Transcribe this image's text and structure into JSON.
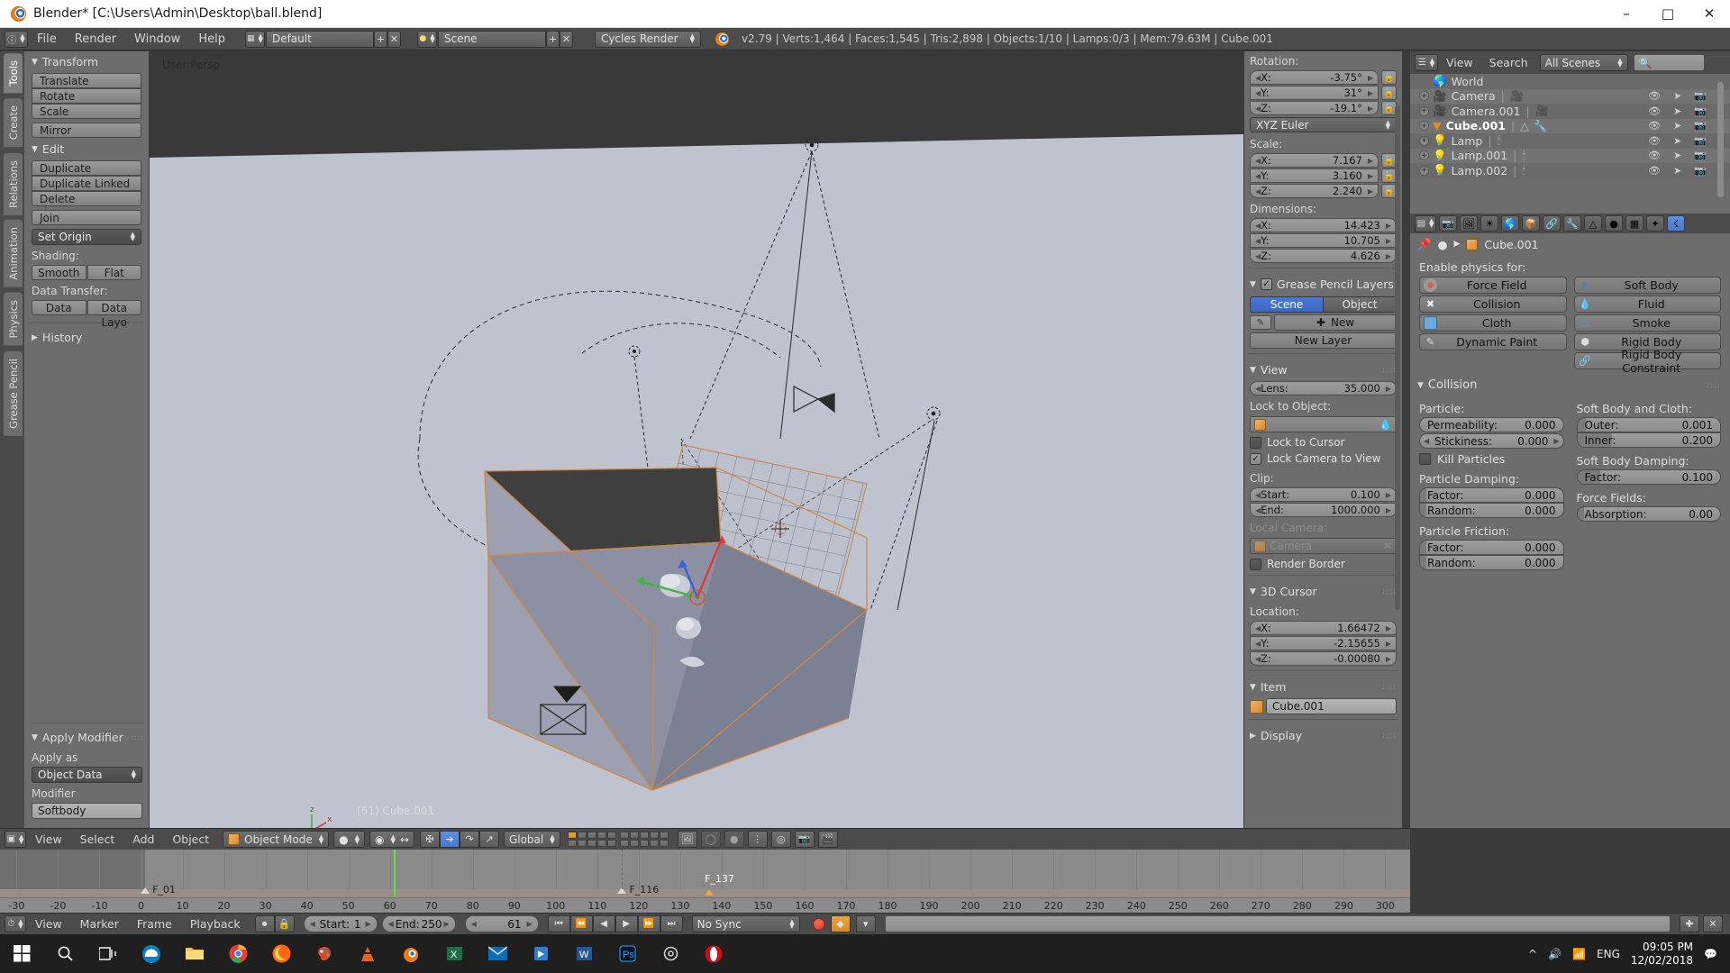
{
  "window": {
    "title": "Blender* [C:\\Users\\Admin\\Desktop\\ball.blend]",
    "minimize": "–",
    "maximize": "□",
    "close": "✕"
  },
  "topbar": {
    "menus": [
      "File",
      "Render",
      "Window",
      "Help"
    ],
    "screen_layout": "Default",
    "scene": "Scene",
    "render_engine": "Cycles Render",
    "status": "v2.79 | Verts:1,464 | Faces:1,545 | Tris:2,898 | Objects:1/10 | Lamps:0/3 | Mem:79.63M | Cube.001",
    "plus": "+",
    "x": "✕"
  },
  "toolshelf": {
    "tabs": [
      "Tools",
      "Create",
      "Relations",
      "Animation",
      "Physics",
      "Grease Pencil"
    ],
    "active_tab": "Tools",
    "transform": {
      "title": "Transform",
      "buttons": [
        "Translate",
        "Rotate",
        "Scale"
      ],
      "mirror": "Mirror"
    },
    "edit": {
      "title": "Edit",
      "buttons": [
        "Duplicate",
        "Duplicate Linked",
        "Delete"
      ],
      "join": "Join",
      "set_origin": "Set Origin",
      "shading_label": "Shading:",
      "shading": [
        "Smooth",
        "Flat"
      ],
      "data_transfer_label": "Data Transfer:",
      "data_transfer": [
        "Data",
        "Data Layo"
      ]
    },
    "history": "History",
    "apply_modifier": {
      "title": "Apply Modifier",
      "apply_as_label": "Apply as",
      "apply_as_value": "Object Data",
      "modifier_label": "Modifier",
      "modifier_value": "Softbody"
    }
  },
  "viewport": {
    "view_label": "User Persp",
    "object_info": "(61) Cube.001"
  },
  "npanel": {
    "rotation": {
      "label": "Rotation:",
      "fields": [
        {
          "key": "X:",
          "value": "-3.75°"
        },
        {
          "key": "Y:",
          "value": "31°"
        },
        {
          "key": "Z:",
          "value": "-19.1°"
        }
      ],
      "mode": "XYZ Euler"
    },
    "scale": {
      "label": "Scale:",
      "fields": [
        {
          "key": "X:",
          "value": "7.167"
        },
        {
          "key": "Y:",
          "value": "3.160"
        },
        {
          "key": "Z:",
          "value": "2.240"
        }
      ]
    },
    "dimensions": {
      "label": "Dimensions:",
      "fields": [
        {
          "key": "X:",
          "value": "14.423"
        },
        {
          "key": "Y:",
          "value": "10.705"
        },
        {
          "key": "Z:",
          "value": "4.626"
        }
      ]
    },
    "grease_pencil": {
      "title": "Grease Pencil Layers",
      "checked": true,
      "tabs": [
        "Scene",
        "Object"
      ],
      "active_tab": "Scene",
      "new_button": "New",
      "new_layer_button": "New Layer"
    },
    "view": {
      "title": "View",
      "lens": {
        "key": "Lens:",
        "value": "35.000"
      },
      "lock_to_object_label": "Lock to Object:",
      "lock_to_object_value": "",
      "lock_to_cursor": "Lock to Cursor",
      "lock_to_cursor_on": false,
      "lock_camera_to_view": "Lock Camera to View",
      "lock_camera_to_view_on": true,
      "clip_label": "Clip:",
      "clip_start": {
        "key": "Start:",
        "value": "0.100"
      },
      "clip_end": {
        "key": "End:",
        "value": "1000.000"
      },
      "local_camera_label": "Local Camera:",
      "local_camera_value": "Camera",
      "render_border": "Render Border",
      "render_border_on": false
    },
    "cursor3d": {
      "title": "3D Cursor",
      "location_label": "Location:",
      "fields": [
        {
          "key": "X:",
          "value": "1.66472"
        },
        {
          "key": "Y:",
          "value": "-2.15655"
        },
        {
          "key": "Z:",
          "value": "-0.00080"
        }
      ]
    },
    "item": {
      "title": "Item",
      "name": "Cube.001"
    },
    "display": {
      "title": "Display"
    }
  },
  "outliner": {
    "menus": [
      "View",
      "Search"
    ],
    "scope": "All Scenes",
    "search_value": "",
    "rows": [
      {
        "name": "World",
        "icon": "world-icon",
        "expandable": false,
        "selected": false,
        "extra": []
      },
      {
        "name": "Camera",
        "icon": "camera-icon",
        "expandable": true,
        "selected": false,
        "extra": [
          "camera-data-icon"
        ]
      },
      {
        "name": "Camera.001",
        "icon": "camera-icon",
        "expandable": true,
        "selected": false,
        "extra": [
          "camera-data-icon"
        ]
      },
      {
        "name": "Cube.001",
        "icon": "mesh-icon",
        "expandable": true,
        "selected": true,
        "extra": [
          "mesh-data-icon",
          "wrench-icon"
        ]
      },
      {
        "name": "Lamp",
        "icon": "lamp-icon",
        "expandable": true,
        "selected": false,
        "extra": [
          "lamp-data-icon"
        ]
      },
      {
        "name": "Lamp.001",
        "icon": "lamp-icon",
        "expandable": true,
        "selected": false,
        "extra": [
          "lamp-data-icon"
        ]
      },
      {
        "name": "Lamp.002",
        "icon": "lamp-icon",
        "expandable": true,
        "selected": false,
        "extra": [
          "lamp-data-icon"
        ]
      }
    ]
  },
  "properties": {
    "breadcrumb": "Cube.001",
    "enable_physics_label": "Enable physics for:",
    "physics_buttons_left": [
      {
        "label": "Force Field",
        "icon": "force-field-icon"
      },
      {
        "label": "Collision",
        "icon": "collision-icon"
      },
      {
        "label": "Cloth",
        "icon": "cloth-icon"
      },
      {
        "label": "Dynamic Paint",
        "icon": "dynamic-paint-icon"
      }
    ],
    "physics_buttons_right": [
      {
        "label": "Soft Body",
        "icon": "soft-body-icon"
      },
      {
        "label": "Fluid",
        "icon": "fluid-icon"
      },
      {
        "label": "Smoke",
        "icon": "smoke-icon"
      },
      {
        "label": "Rigid Body",
        "icon": "rigid-body-icon"
      },
      {
        "label": "Rigid Body Constraint",
        "icon": "rigid-body-constraint-icon"
      }
    ],
    "collision": {
      "title": "Collision",
      "particle_label": "Particle:",
      "permeability": {
        "key": "Permeability:",
        "value": "0.000"
      },
      "stickiness": {
        "key": "Stickiness:",
        "value": "0.000"
      },
      "kill_particles": "Kill Particles",
      "kill_particles_on": false,
      "particle_damping_label": "Particle Damping:",
      "particle_damping_factor": {
        "key": "Factor:",
        "value": "0.000"
      },
      "particle_damping_random": {
        "key": "Random:",
        "value": "0.000"
      },
      "particle_friction_label": "Particle Friction:",
      "particle_friction_factor": {
        "key": "Factor:",
        "value": "0.000"
      },
      "particle_friction_random": {
        "key": "Random:",
        "value": "0.000"
      },
      "soft_body_cloth_label": "Soft Body and Cloth:",
      "outer": {
        "key": "Outer:",
        "value": "0.001"
      },
      "inner": {
        "key": "Inner:",
        "value": "0.200"
      },
      "soft_body_damping_label": "Soft Body Damping:",
      "sb_damping_factor": {
        "key": "Factor:",
        "value": "0.100"
      },
      "force_fields_label": "Force Fields:",
      "absorption": {
        "key": "Absorption:",
        "value": "0.00"
      }
    }
  },
  "viewport_header": {
    "menus": [
      "View",
      "Select",
      "Add",
      "Object"
    ],
    "mode": "Object Mode",
    "transform_orientation": "Global"
  },
  "timeline": {
    "ticks": [
      -30,
      -20,
      -10,
      0,
      10,
      20,
      30,
      40,
      50,
      60,
      70,
      80,
      90,
      100,
      110,
      120,
      130,
      140,
      150,
      160,
      170,
      180,
      190,
      200,
      210,
      220,
      230,
      240,
      250,
      260,
      270,
      280,
      290,
      300
    ],
    "markers": [
      {
        "label": "F_01",
        "frame": 1,
        "selected": false
      },
      {
        "label": "F_116",
        "frame": 116,
        "selected": false
      },
      {
        "label": "F_137",
        "frame": 137,
        "selected": true
      }
    ],
    "playhead_frame": 61,
    "header": {
      "menus": [
        "View",
        "Marker",
        "Frame",
        "Playback"
      ],
      "start": {
        "key": "Start:",
        "value": "1"
      },
      "end": {
        "key": "End:",
        "value": "250"
      },
      "current": "61",
      "sync": "No Sync"
    }
  },
  "taskbar": {
    "icons": [
      "windows-start-icon",
      "search-icon",
      "task-view-icon",
      "edge-icon",
      "file-explorer-icon",
      "chrome-icon",
      "firefox-icon",
      "paint-icon",
      "vlc-icon",
      "blender-icon",
      "excel-icon",
      "mail-icon",
      "store-icon",
      "word-icon",
      "photoshop-icon",
      "settings-icon",
      "opera-icon"
    ],
    "language": "ENG",
    "time": "09:05 PM",
    "date": "12/02/2018",
    "show_hidden": "^"
  }
}
